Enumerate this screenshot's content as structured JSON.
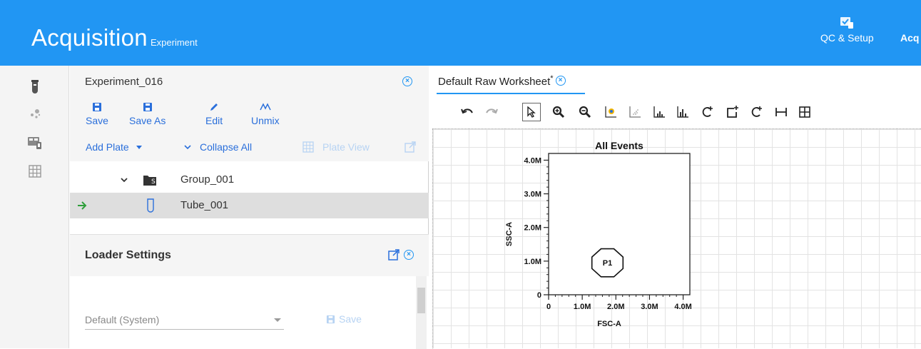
{
  "header": {
    "title": "Acquisition",
    "subtitle": "Experiment",
    "nav": [
      {
        "label": "QC & Setup",
        "icon": "qc-setup-icon"
      },
      {
        "label": "Acq"
      }
    ]
  },
  "rail": {
    "items": [
      {
        "icon": "tube-icon"
      },
      {
        "icon": "dots-icon"
      },
      {
        "icon": "plate-config-icon"
      },
      {
        "icon": "grid-icon"
      }
    ]
  },
  "experiment": {
    "title": "Experiment_016",
    "toolbar": [
      {
        "label": "Save",
        "icon": "save-icon"
      },
      {
        "label": "Save As",
        "icon": "save-as-icon"
      },
      {
        "label": "Edit",
        "icon": "pencil-icon"
      },
      {
        "label": "Unmix",
        "icon": "unmix-icon"
      }
    ],
    "actions": {
      "add_plate": "Add Plate",
      "collapse_all": "Collapse All",
      "plate_view": "Plate View"
    },
    "tree": [
      {
        "label": "Group_001",
        "badge": "S",
        "icon": "folder-icon"
      },
      {
        "label": "Tube_001",
        "icon": "tube-icon",
        "selected": true
      }
    ]
  },
  "loader": {
    "title": "Loader Settings",
    "dropdown_value": "Default (System)",
    "save_label": "Save"
  },
  "worksheet": {
    "tab_label": "Default Raw Worksheet",
    "tab_modified_marker": "*",
    "tools": [
      "undo-icon",
      "redo-icon",
      "pointer-icon",
      "zoom-in-icon",
      "zoom-out-icon",
      "dot-plot-icon",
      "density-plot-icon",
      "histogram-icon",
      "overlay-histogram-icon",
      "polygon-gate-icon",
      "rectangle-gate-icon",
      "ellipse-gate-icon",
      "interval-gate-icon",
      "quadrant-gate-icon"
    ]
  },
  "chart_data": {
    "type": "scatter",
    "title": "All Events",
    "xlabel": "FSC-A",
    "ylabel": "SSC-A",
    "x_ticks": [
      "0",
      "1.0M",
      "2.0M",
      "3.0M",
      "4.0M"
    ],
    "y_ticks": [
      "0",
      "1.0M",
      "2.0M",
      "3.0M",
      "4.0M"
    ],
    "xlim": [
      0,
      4200000
    ],
    "ylim": [
      0,
      4200000
    ],
    "grid": false,
    "points": [],
    "gates": [
      {
        "name": "P1",
        "shape": "octagon",
        "center": [
          1750000,
          950000
        ],
        "radius": [
          500000,
          450000
        ]
      }
    ]
  },
  "colors": {
    "header_bg": "#2196f3",
    "link": "#2a6fdb",
    "disabled": "#b7d3f3",
    "selection_bg": "#dedede",
    "arrow_green": "#2e9e3a"
  }
}
